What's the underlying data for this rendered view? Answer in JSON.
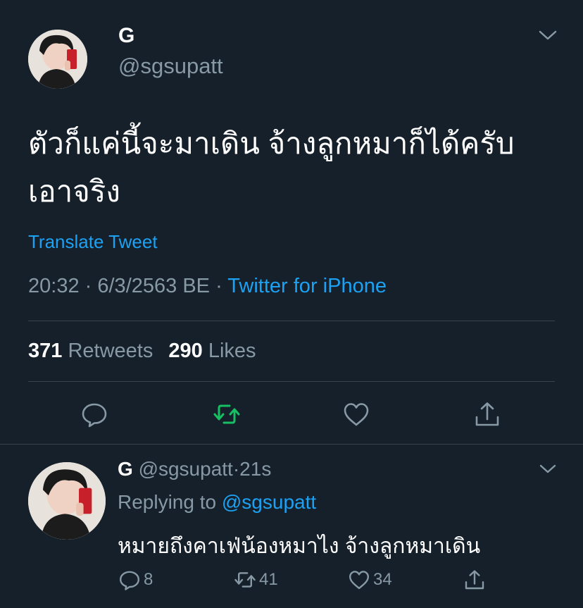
{
  "main_tweet": {
    "display_name": "G",
    "handle": "@sgsupatt",
    "text_line1": "ตัวก็แค่นี้จะมาเดิน จ้างลูกหมาก็ได้ครับ",
    "text_line2": "เอาจริง",
    "translate_label": "Translate Tweet",
    "time": "20:32",
    "date": "6/3/2563 BE",
    "separator": "·",
    "source": "Twitter for iPhone",
    "retweets_count": "371",
    "retweets_label": "Retweets",
    "likes_count": "290",
    "likes_label": "Likes",
    "icons": {
      "reply": "reply-icon",
      "retweet": "retweet-icon",
      "like": "heart-icon",
      "share": "share-icon",
      "more": "chevron-down-icon"
    }
  },
  "reply_tweet": {
    "display_name": "G",
    "handle": "@sgsupatt",
    "separator": "·",
    "age": "21s",
    "replying_prefix": "Replying to",
    "replying_handle": "@sgsupatt",
    "text": "หมายถึงคาเฟ่น้องหมาไง จ้างลูกหมาเดิน",
    "reply_count": "8",
    "retweet_count": "41",
    "like_count": "34"
  },
  "colors": {
    "background": "#15202b",
    "text": "#ffffff",
    "muted": "#8899a6",
    "link": "#1da1f2",
    "retweeted": "#17bf63",
    "divider": "#38444d"
  }
}
